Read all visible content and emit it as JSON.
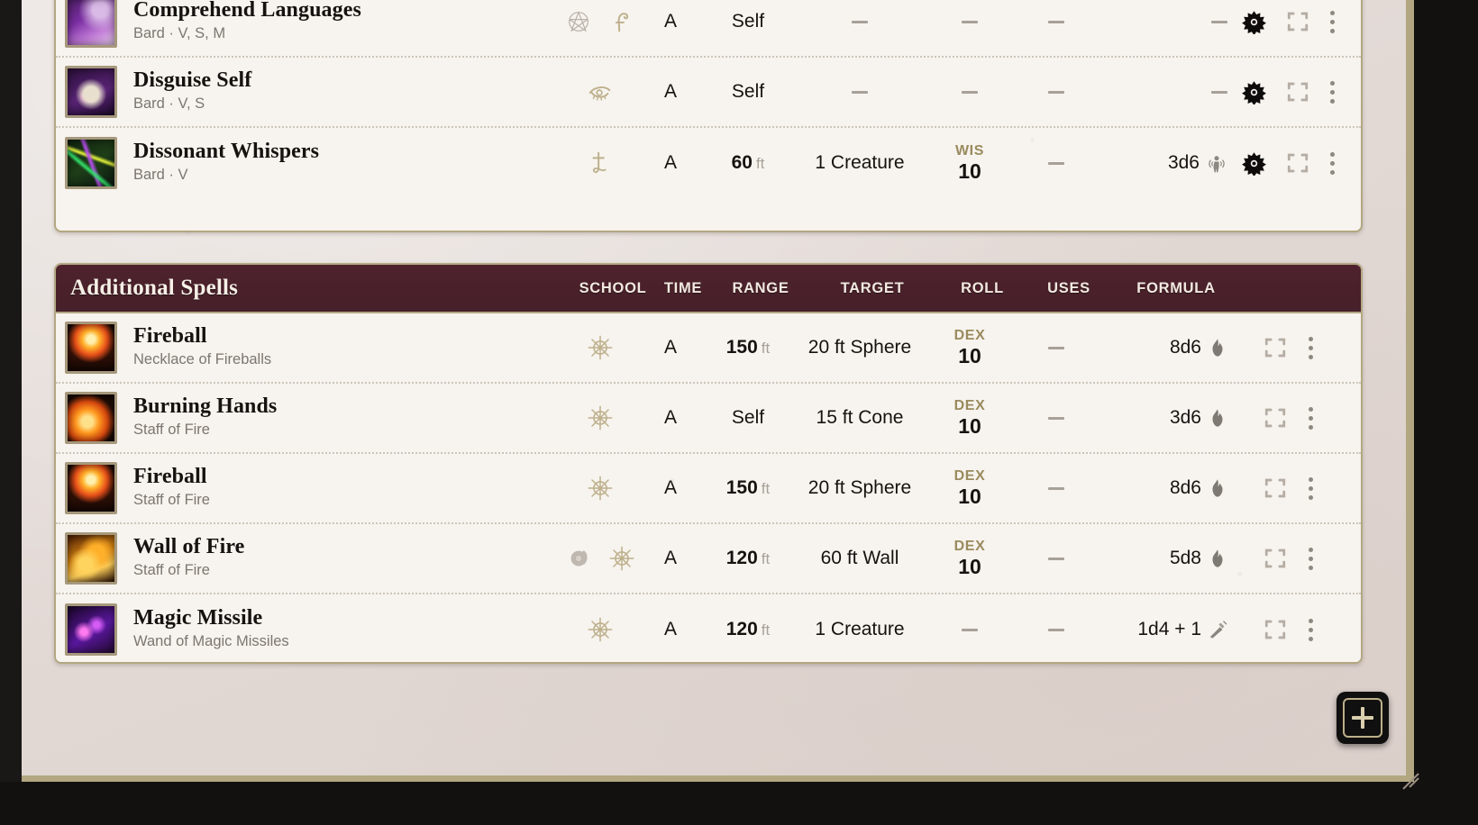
{
  "sections": [
    {
      "id": "prepared",
      "title": "",
      "show_header": false,
      "columns": [
        "SCHOOL",
        "TIME",
        "RANGE",
        "TARGET",
        "ROLL",
        "USES",
        "FORMULA"
      ],
      "rows": [
        {
          "name": "Comprehend Languages",
          "subtitle": "Bard · V, S, M",
          "icon_art": "img-comprehend",
          "symbols": [
            "ritual-pentacle-icon",
            "divination-squiggle-icon"
          ],
          "time": "A",
          "range": "Self",
          "range_unit": "",
          "target": "–",
          "roll_abbr": "",
          "roll_dc": "–",
          "uses": "–",
          "formula": "–",
          "formula_icon": "",
          "controls": [
            "gear-icon",
            "expand-icon",
            "kebab-icon"
          ]
        },
        {
          "name": "Disguise Self",
          "subtitle": "Bard · V, S",
          "icon_art": "img-disguise",
          "symbols": [
            "illusion-eye-icon"
          ],
          "time": "A",
          "range": "Self",
          "range_unit": "",
          "target": "–",
          "roll_abbr": "",
          "roll_dc": "–",
          "uses": "–",
          "formula": "–",
          "formula_icon": "",
          "controls": [
            "gear-icon",
            "expand-icon",
            "kebab-icon"
          ]
        },
        {
          "name": "Dissonant Whispers",
          "subtitle": "Bard · V",
          "icon_art": "img-dissonant",
          "symbols": [
            "enchantment-rune-icon"
          ],
          "time": "A",
          "range": "60",
          "range_unit": "ft",
          "target": "1 Creature",
          "roll_abbr": "WIS",
          "roll_dc": "10",
          "uses": "–",
          "formula": "3d6",
          "formula_icon": "psychic-damage-icon",
          "controls": [
            "gear-icon",
            "expand-icon",
            "kebab-icon"
          ]
        }
      ]
    },
    {
      "id": "additional",
      "title": "Additional Spells",
      "show_header": true,
      "columns": [
        "SCHOOL",
        "TIME",
        "RANGE",
        "TARGET",
        "ROLL",
        "USES",
        "FORMULA"
      ],
      "rows": [
        {
          "name": "Fireball",
          "subtitle": "Necklace of Fireballs",
          "icon_art": "img-fireball",
          "symbols": [
            "evocation-sun-icon"
          ],
          "time": "A",
          "range": "150",
          "range_unit": "ft",
          "target": "20 ft Sphere",
          "roll_abbr": "DEX",
          "roll_dc": "10",
          "uses": "–",
          "formula": "8d6",
          "formula_icon": "fire-damage-icon",
          "controls": [
            "expand-icon",
            "kebab-icon"
          ]
        },
        {
          "name": "Burning Hands",
          "subtitle": "Staff of Fire",
          "icon_art": "img-burning",
          "symbols": [
            "evocation-sun-icon"
          ],
          "time": "A",
          "range": "Self",
          "range_unit": "",
          "target": "15 ft Cone",
          "roll_abbr": "DEX",
          "roll_dc": "10",
          "uses": "–",
          "formula": "3d6",
          "formula_icon": "fire-damage-icon",
          "controls": [
            "expand-icon",
            "kebab-icon"
          ]
        },
        {
          "name": "Fireball",
          "subtitle": "Staff of Fire",
          "icon_art": "img-fireball",
          "symbols": [
            "evocation-sun-icon"
          ],
          "time": "A",
          "range": "150",
          "range_unit": "ft",
          "target": "20 ft Sphere",
          "roll_abbr": "DEX",
          "roll_dc": "10",
          "uses": "–",
          "formula": "8d6",
          "formula_icon": "fire-damage-icon",
          "controls": [
            "expand-icon",
            "kebab-icon"
          ]
        },
        {
          "name": "Wall of Fire",
          "subtitle": "Staff of Fire",
          "icon_art": "img-wall",
          "symbols": [
            "concentration-icon",
            "evocation-sun-icon"
          ],
          "time": "A",
          "range": "120",
          "range_unit": "ft",
          "target": "60 ft Wall",
          "roll_abbr": "DEX",
          "roll_dc": "10",
          "uses": "–",
          "formula": "5d8",
          "formula_icon": "fire-damage-icon",
          "controls": [
            "expand-icon",
            "kebab-icon"
          ]
        },
        {
          "name": "Magic Missile",
          "subtitle": "Wand of Magic Missiles",
          "icon_art": "img-missile",
          "symbols": [
            "evocation-sun-icon"
          ],
          "time": "A",
          "range": "120",
          "range_unit": "ft",
          "target": "1 Creature",
          "roll_abbr": "",
          "roll_dc": "–",
          "uses": "–",
          "formula": "1d4 + 1",
          "formula_icon": "force-damage-icon",
          "controls": [
            "expand-icon",
            "kebab-icon"
          ]
        }
      ]
    }
  ],
  "add_button": {
    "label": "+",
    "name": "add-spell-button"
  },
  "colors": {
    "header_maroon": "#4e222c",
    "sheet_border_gold": "#b3a781",
    "row_bg": "#f7f3ee",
    "ability_gold": "#9a8b5e"
  }
}
